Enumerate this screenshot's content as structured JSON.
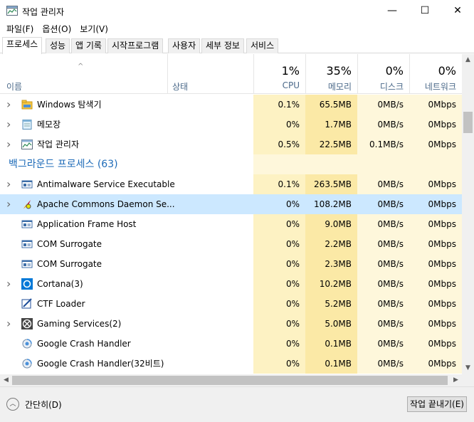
{
  "window": {
    "title": "작업 관리자",
    "min_glyph": "—",
    "max_glyph": "☐",
    "close_glyph": "✕"
  },
  "menu": [
    "파일(F)",
    "옵션(O)",
    "보기(V)"
  ],
  "tabs": [
    {
      "label": "프로세스",
      "active": true
    },
    {
      "label": "성능"
    },
    {
      "label": "앱 기록"
    },
    {
      "label": "시작프로그램"
    },
    {
      "label": "사용자"
    },
    {
      "label": "세부 정보"
    },
    {
      "label": "서비스"
    }
  ],
  "columns": {
    "name": "이름",
    "status": "상태",
    "cpu": {
      "pct": "1%",
      "label": "CPU"
    },
    "memory": {
      "pct": "35%",
      "label": "메모리"
    },
    "disk": {
      "pct": "0%",
      "label": "디스크"
    },
    "network": {
      "pct": "0%",
      "label": "네트워크"
    }
  },
  "rows": [
    {
      "type": "process",
      "expand": true,
      "icon": "explorer-icon",
      "name": "Windows 탐색기",
      "cpu": "0.1%",
      "mem": "65.5MB",
      "disk": "0MB/s",
      "net": "0Mbps"
    },
    {
      "type": "process",
      "expand": true,
      "icon": "notepad-icon",
      "name": "메모장",
      "cpu": "0%",
      "mem": "1.7MB",
      "disk": "0MB/s",
      "net": "0Mbps"
    },
    {
      "type": "process",
      "expand": true,
      "icon": "task-manager-icon",
      "name": "작업 관리자",
      "cpu": "0.5%",
      "mem": "22.5MB",
      "disk": "0.1MB/s",
      "net": "0Mbps"
    },
    {
      "type": "group",
      "name": "백그라운드 프로세스 (63)"
    },
    {
      "type": "process",
      "expand": true,
      "icon": "service-icon",
      "name": "Antimalware Service Executable",
      "cpu": "0.1%",
      "mem": "263.5MB",
      "disk": "0MB/s",
      "net": "0Mbps"
    },
    {
      "type": "process",
      "expand": true,
      "selected": true,
      "icon": "apache-feather-icon",
      "name": "Apache Commons Daemon Se...",
      "cpu": "0%",
      "mem": "108.2MB",
      "disk": "0MB/s",
      "net": "0Mbps"
    },
    {
      "type": "process",
      "expand": false,
      "icon": "service-icon",
      "name": "Application Frame Host",
      "cpu": "0%",
      "mem": "9.0MB",
      "disk": "0MB/s",
      "net": "0Mbps"
    },
    {
      "type": "process",
      "expand": false,
      "icon": "service-icon",
      "name": "COM Surrogate",
      "cpu": "0%",
      "mem": "2.2MB",
      "disk": "0MB/s",
      "net": "0Mbps"
    },
    {
      "type": "process",
      "expand": false,
      "icon": "service-icon",
      "name": "COM Surrogate",
      "cpu": "0%",
      "mem": "2.3MB",
      "disk": "0MB/s",
      "net": "0Mbps"
    },
    {
      "type": "process",
      "expand": true,
      "icon": "cortana-icon",
      "name": "Cortana(3)",
      "cpu": "0%",
      "mem": "10.2MB",
      "disk": "0MB/s",
      "net": "0Mbps"
    },
    {
      "type": "process",
      "expand": false,
      "icon": "ctf-loader-icon",
      "name": "CTF Loader",
      "cpu": "0%",
      "mem": "5.2MB",
      "disk": "0MB/s",
      "net": "0Mbps"
    },
    {
      "type": "process",
      "expand": true,
      "icon": "xbox-icon",
      "name": "Gaming Services(2)",
      "cpu": "0%",
      "mem": "5.0MB",
      "disk": "0MB/s",
      "net": "0Mbps"
    },
    {
      "type": "process",
      "expand": false,
      "icon": "google-crash-icon",
      "name": "Google Crash Handler",
      "cpu": "0%",
      "mem": "0.1MB",
      "disk": "0MB/s",
      "net": "0Mbps"
    },
    {
      "type": "process",
      "expand": false,
      "icon": "google-crash-icon",
      "name": "Google Crash Handler(32비트)",
      "cpu": "0%",
      "mem": "0.1MB",
      "disk": "0MB/s",
      "net": "0Mbps"
    }
  ],
  "footer": {
    "fewer_details": "간단히(D)",
    "end_task": "작업 끝내기(E)"
  },
  "colors": {
    "selected_row": "#cce8ff",
    "heat_light": "#fdf2c3",
    "heat_mid": "#fbe9a6",
    "group_title": "#1e6bb8",
    "header_label": "#4c6a8a"
  }
}
